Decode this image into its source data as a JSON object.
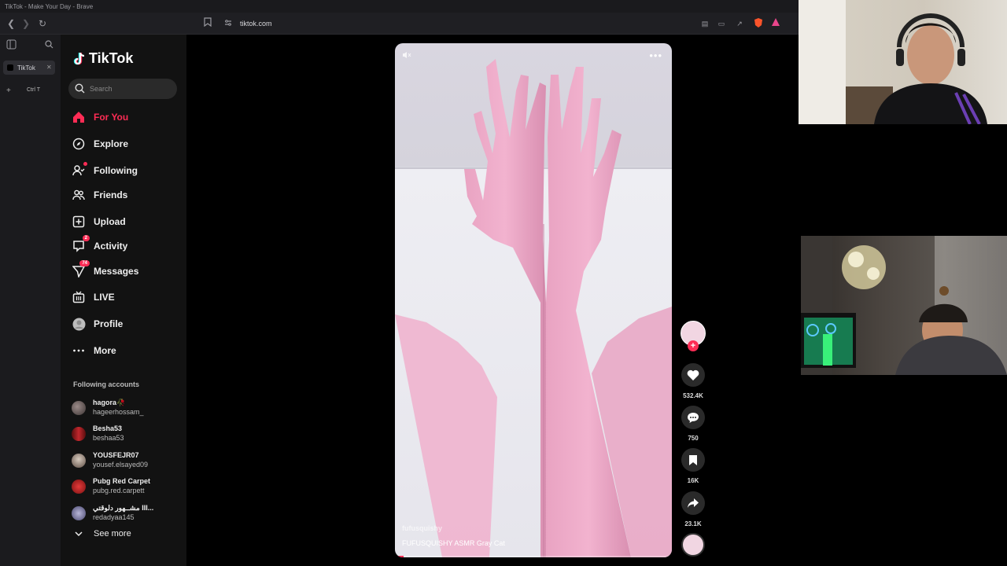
{
  "window": {
    "title": "TikTok - Make Your Day - Brave"
  },
  "browser": {
    "url": "tiktok.com",
    "tab_title": "TikTok",
    "new_tab_shortcut": "Ctrl  T",
    "shields_count": "1"
  },
  "brand": {
    "name": "TikTok",
    "accent": "#fe2c55"
  },
  "search": {
    "placeholder": "Search"
  },
  "nav": {
    "for_you": "For You",
    "explore": "Explore",
    "following": "Following",
    "friends": "Friends",
    "upload": "Upload",
    "activity": "Activity",
    "activity_badge": "2",
    "messages": "Messages",
    "messages_badge": "74",
    "live": "LIVE",
    "profile": "Profile",
    "more": "More"
  },
  "following_accounts": {
    "title": "Following accounts",
    "items": [
      {
        "name": "hagora🥀",
        "username": "hageerhossam_"
      },
      {
        "name": "Besha53",
        "username": "beshaa53"
      },
      {
        "name": "YOUSFEJR07",
        "username": "yousef.elsayed09"
      },
      {
        "name": "Pubg Red Carpet",
        "username": "pubg.red.carpett"
      },
      {
        "name": "مشــهور دلوقتي III...",
        "username": "redadyaa145"
      }
    ],
    "see_more": "See more"
  },
  "video": {
    "creator": "fufusquishy",
    "caption": "FUFUSQUISHY ASMR Gray Cat",
    "progress_fraction": 0.03
  },
  "actions": {
    "likes": "532.4K",
    "comments": "750",
    "saves": "16K",
    "shares": "23.1K"
  }
}
